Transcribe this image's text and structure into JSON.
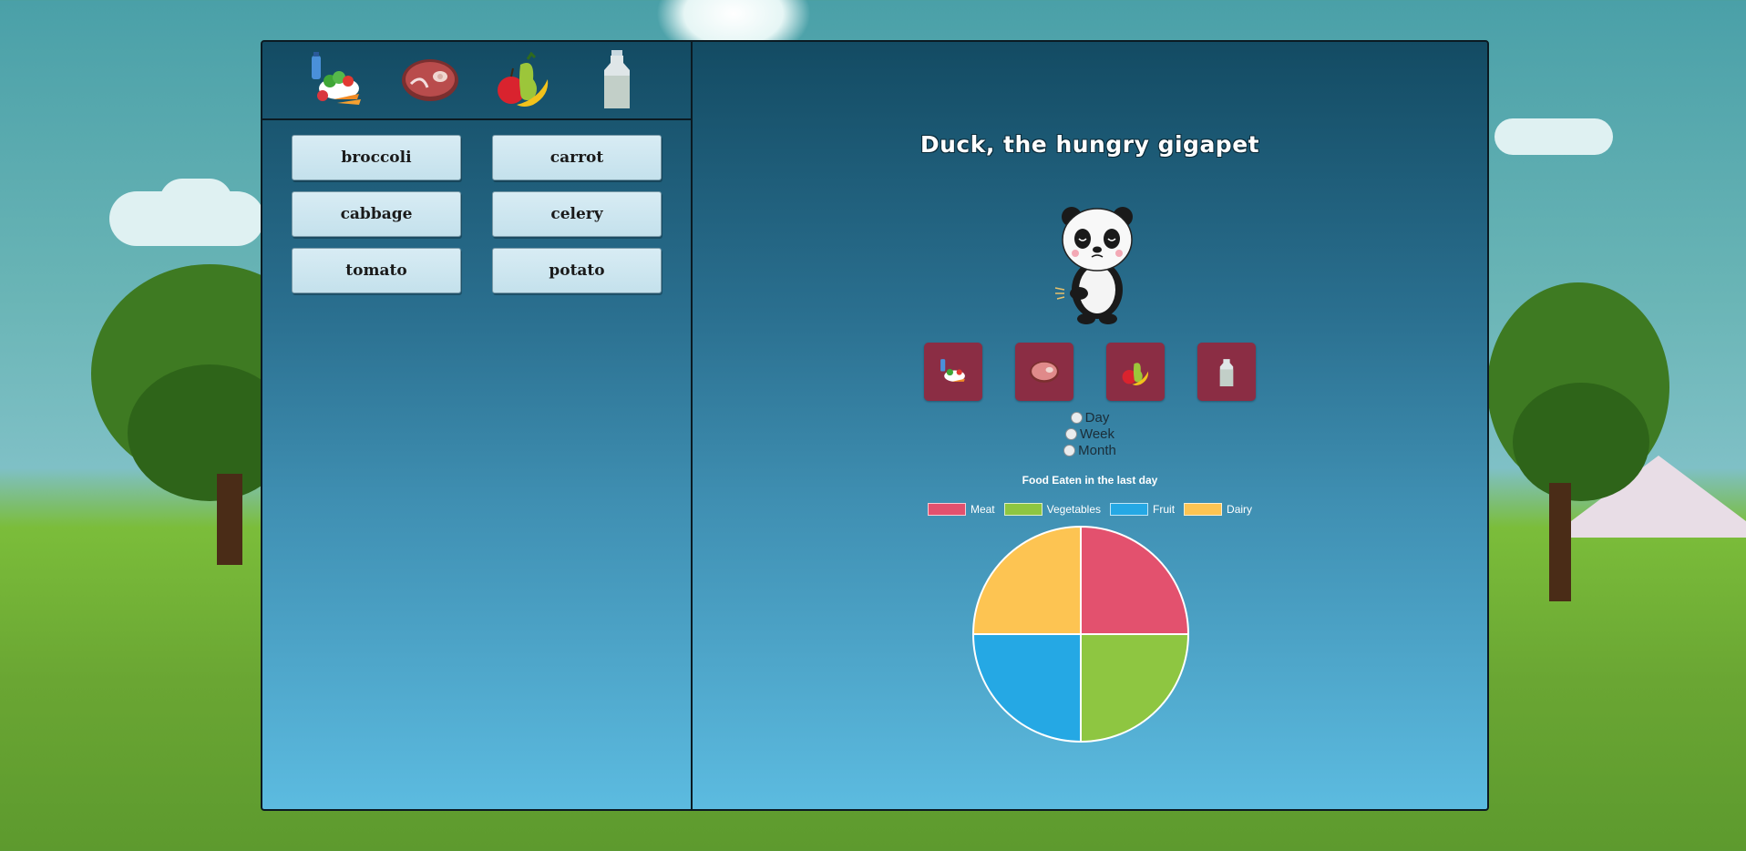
{
  "food_tabs": [
    {
      "name": "vegetables",
      "icon": "vegetables-icon"
    },
    {
      "name": "meat",
      "icon": "meat-icon"
    },
    {
      "name": "fruit",
      "icon": "fruit-icon"
    },
    {
      "name": "dairy",
      "icon": "milk-icon"
    }
  ],
  "food_items": [
    {
      "label": "broccoli"
    },
    {
      "label": "carrot"
    },
    {
      "label": "cabbage"
    },
    {
      "label": "celery"
    },
    {
      "label": "tomato"
    },
    {
      "label": "potato"
    }
  ],
  "pet": {
    "title": "Duck, the hungry gigapet",
    "avatar_icon": "panda-icon"
  },
  "feed_buttons": [
    {
      "icon": "vegetables-icon"
    },
    {
      "icon": "meat-icon"
    },
    {
      "icon": "fruit-icon"
    },
    {
      "icon": "milk-icon"
    }
  ],
  "periods": [
    {
      "label": "Day"
    },
    {
      "label": "Week"
    },
    {
      "label": "Month"
    }
  ],
  "chart_data": {
    "type": "pie",
    "title": "Food Eaten in the last day",
    "legend_position": "top",
    "categories": [
      "Meat",
      "Vegetables",
      "Fruit",
      "Dairy"
    ],
    "values": [
      1,
      1,
      1,
      1
    ],
    "colors": [
      "#e3516e",
      "#8ec641",
      "#25a8e4",
      "#fdc452"
    ]
  },
  "colors": {
    "frame_top": "#134b63",
    "frame_bottom": "#5cbbe0",
    "feed_button": "#8b2d44",
    "food_button": "#c4e1ec"
  }
}
